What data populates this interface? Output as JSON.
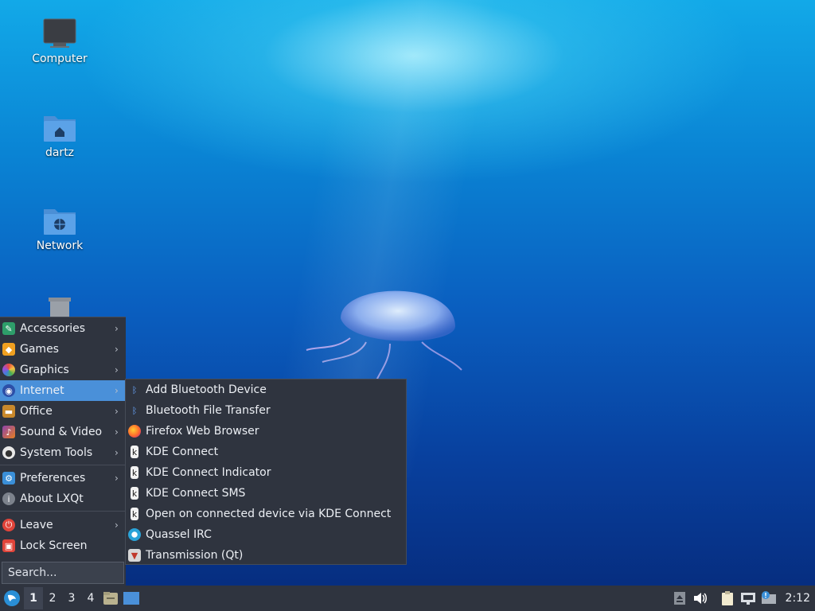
{
  "desktop": {
    "icons": [
      {
        "label": "Computer",
        "icon": "computer-icon"
      },
      {
        "label": "dartz",
        "icon": "home-folder-icon"
      },
      {
        "label": "Network",
        "icon": "network-folder-icon"
      },
      {
        "label": "",
        "icon": "trash-icon"
      }
    ]
  },
  "menu": {
    "items": [
      {
        "label": "Accessories",
        "icon": "accessories-icon",
        "submenu": true
      },
      {
        "label": "Games",
        "icon": "games-icon",
        "submenu": true
      },
      {
        "label": "Graphics",
        "icon": "graphics-icon",
        "submenu": true
      },
      {
        "label": "Internet",
        "icon": "internet-icon",
        "submenu": true,
        "active": true
      },
      {
        "label": "Office",
        "icon": "office-icon",
        "submenu": true
      },
      {
        "label": "Sound & Video",
        "icon": "multimedia-icon",
        "submenu": true
      },
      {
        "label": "System Tools",
        "icon": "system-tools-icon",
        "submenu": true
      },
      {
        "label": "Preferences",
        "icon": "preferences-icon",
        "submenu": true
      },
      {
        "label": "About LXQt",
        "icon": "info-icon",
        "submenu": false
      },
      {
        "label": "Leave",
        "icon": "power-icon",
        "submenu": true
      },
      {
        "label": "Lock Screen",
        "icon": "lock-icon",
        "submenu": false
      }
    ],
    "search_placeholder": "Search..."
  },
  "submenu": {
    "items": [
      {
        "label": "Add Bluetooth Device",
        "icon": "bluetooth-icon"
      },
      {
        "label": "Bluetooth File Transfer",
        "icon": "bluetooth-icon"
      },
      {
        "label": "Firefox Web Browser",
        "icon": "firefox-icon"
      },
      {
        "label": "KDE Connect",
        "icon": "kdeconnect-icon"
      },
      {
        "label": "KDE Connect Indicator",
        "icon": "kdeconnect-icon"
      },
      {
        "label": "KDE Connect SMS",
        "icon": "kdeconnect-icon"
      },
      {
        "label": "Open on connected device via KDE Connect",
        "icon": "kdeconnect-icon"
      },
      {
        "label": "Quassel IRC",
        "icon": "quassel-icon"
      },
      {
        "label": "Transmission (Qt)",
        "icon": "transmission-icon"
      }
    ]
  },
  "taskbar": {
    "workspaces": [
      "1",
      "2",
      "3",
      "4"
    ],
    "active_workspace": "1",
    "clock": "2:12"
  },
  "colors": {
    "panel": "#2f343f",
    "accent": "#4a90d9"
  }
}
